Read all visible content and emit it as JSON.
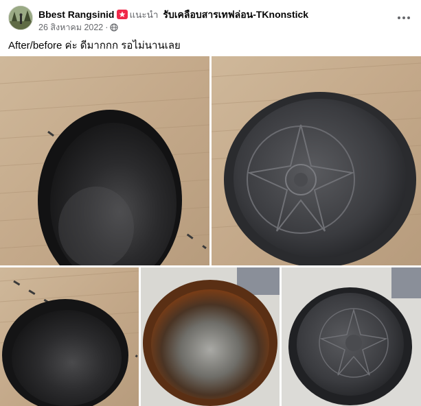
{
  "post": {
    "author": "Bbest Rangsinid",
    "badge_label": "แนะนำ",
    "group": "รับเคลือบสารเทฟล่อน-TKnonstick",
    "date": "26 สิงหาคม 2022",
    "separator": "·",
    "caption": "After/before ค่ะ ดีมากกก รอไม่นานเลย",
    "privacy_icon": "globe-icon",
    "menu_icon": "more-options-icon"
  },
  "colors": {
    "badge": "#f02849",
    "secondary_text": "#65676b",
    "primary_text": "#050505"
  },
  "photos": [
    {
      "id": "pan-inside-after"
    },
    {
      "id": "pan-bottom-after"
    },
    {
      "id": "pan-side-after"
    },
    {
      "id": "pan-inside-before"
    },
    {
      "id": "pan-bottom-after-2"
    }
  ]
}
